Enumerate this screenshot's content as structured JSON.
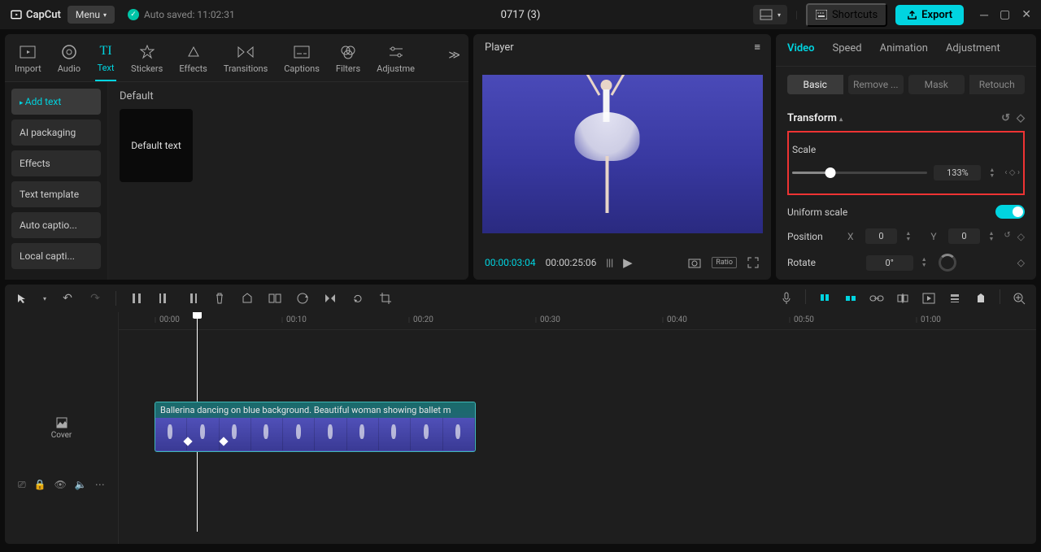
{
  "app": {
    "name": "CapCut",
    "menu_label": "Menu",
    "autosave": "Auto saved: 11:02:31",
    "project": "0717 (3)"
  },
  "topright": {
    "shortcuts": "Shortcuts",
    "export": "Export"
  },
  "tabs": {
    "import": "Import",
    "audio": "Audio",
    "text": "Text",
    "stickers": "Stickers",
    "effects": "Effects",
    "transitions": "Transitions",
    "captions": "Captions",
    "filters": "Filters",
    "adjust": "Adjustme"
  },
  "side": {
    "add": "Add text",
    "ai": "AI packaging",
    "effects": "Effects",
    "template": "Text template",
    "autocap": "Auto captio...",
    "localcap": "Local capti..."
  },
  "content": {
    "heading": "Default",
    "thumb": "Default text"
  },
  "player": {
    "title": "Player",
    "current": "00:00:03:04",
    "total": "00:00:25:06"
  },
  "rtabs": {
    "video": "Video",
    "speed": "Speed",
    "animation": "Animation",
    "adjustment": "Adjustment"
  },
  "rsub": {
    "basic": "Basic",
    "remove": "Remove ...",
    "mask": "Mask",
    "retouch": "Retouch"
  },
  "transform": {
    "title": "Transform",
    "scale_lbl": "Scale",
    "scale_val": "133%",
    "uniform_lbl": "Uniform scale",
    "position_lbl": "Position",
    "x_lbl": "X",
    "x_val": "0",
    "y_lbl": "Y",
    "y_val": "0",
    "rotate_lbl": "Rotate",
    "rotate_val": "0°"
  },
  "ruler": {
    "t0": "00:00",
    "t10": "00:10",
    "t20": "00:20",
    "t30": "00:30",
    "t40": "00:40",
    "t50": "00:50",
    "t60": "01:00"
  },
  "clip": {
    "title": "Ballerina dancing on blue background. Beautiful woman showing ballet m"
  },
  "cover": {
    "label": "Cover"
  }
}
